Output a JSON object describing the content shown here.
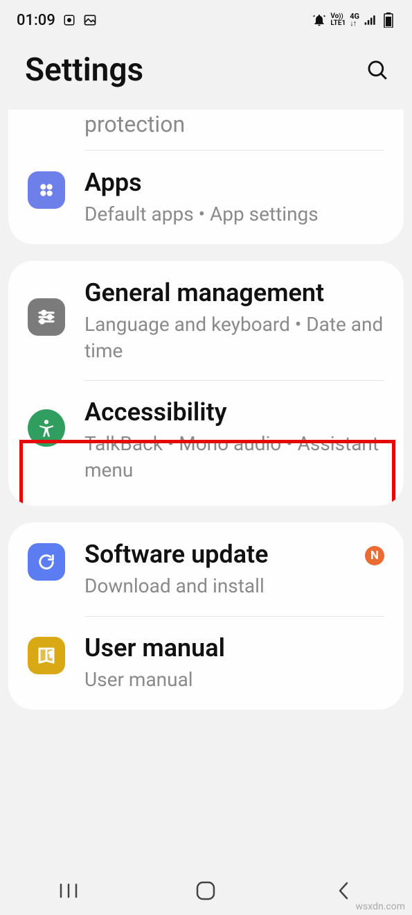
{
  "status": {
    "time": "01:09",
    "volte": "Vo",
    "lte": "LTE1",
    "net": "4G"
  },
  "header": {
    "title": "Settings"
  },
  "partial_item": {
    "subtitle": "protection"
  },
  "apps": {
    "title": "Apps",
    "subtitle": "Default apps  •  App settings"
  },
  "general": {
    "title": "General management",
    "subtitle": "Language and keyboard  •  Date and time"
  },
  "accessibility": {
    "title": "Accessibility",
    "subtitle": "TalkBack  •  Mono audio  •  Assistant menu"
  },
  "software": {
    "title": "Software update",
    "subtitle": "Download and install",
    "badge": "N"
  },
  "usermanual": {
    "title": "User manual",
    "subtitle": "User manual"
  },
  "watermark": "wsxdn.com"
}
